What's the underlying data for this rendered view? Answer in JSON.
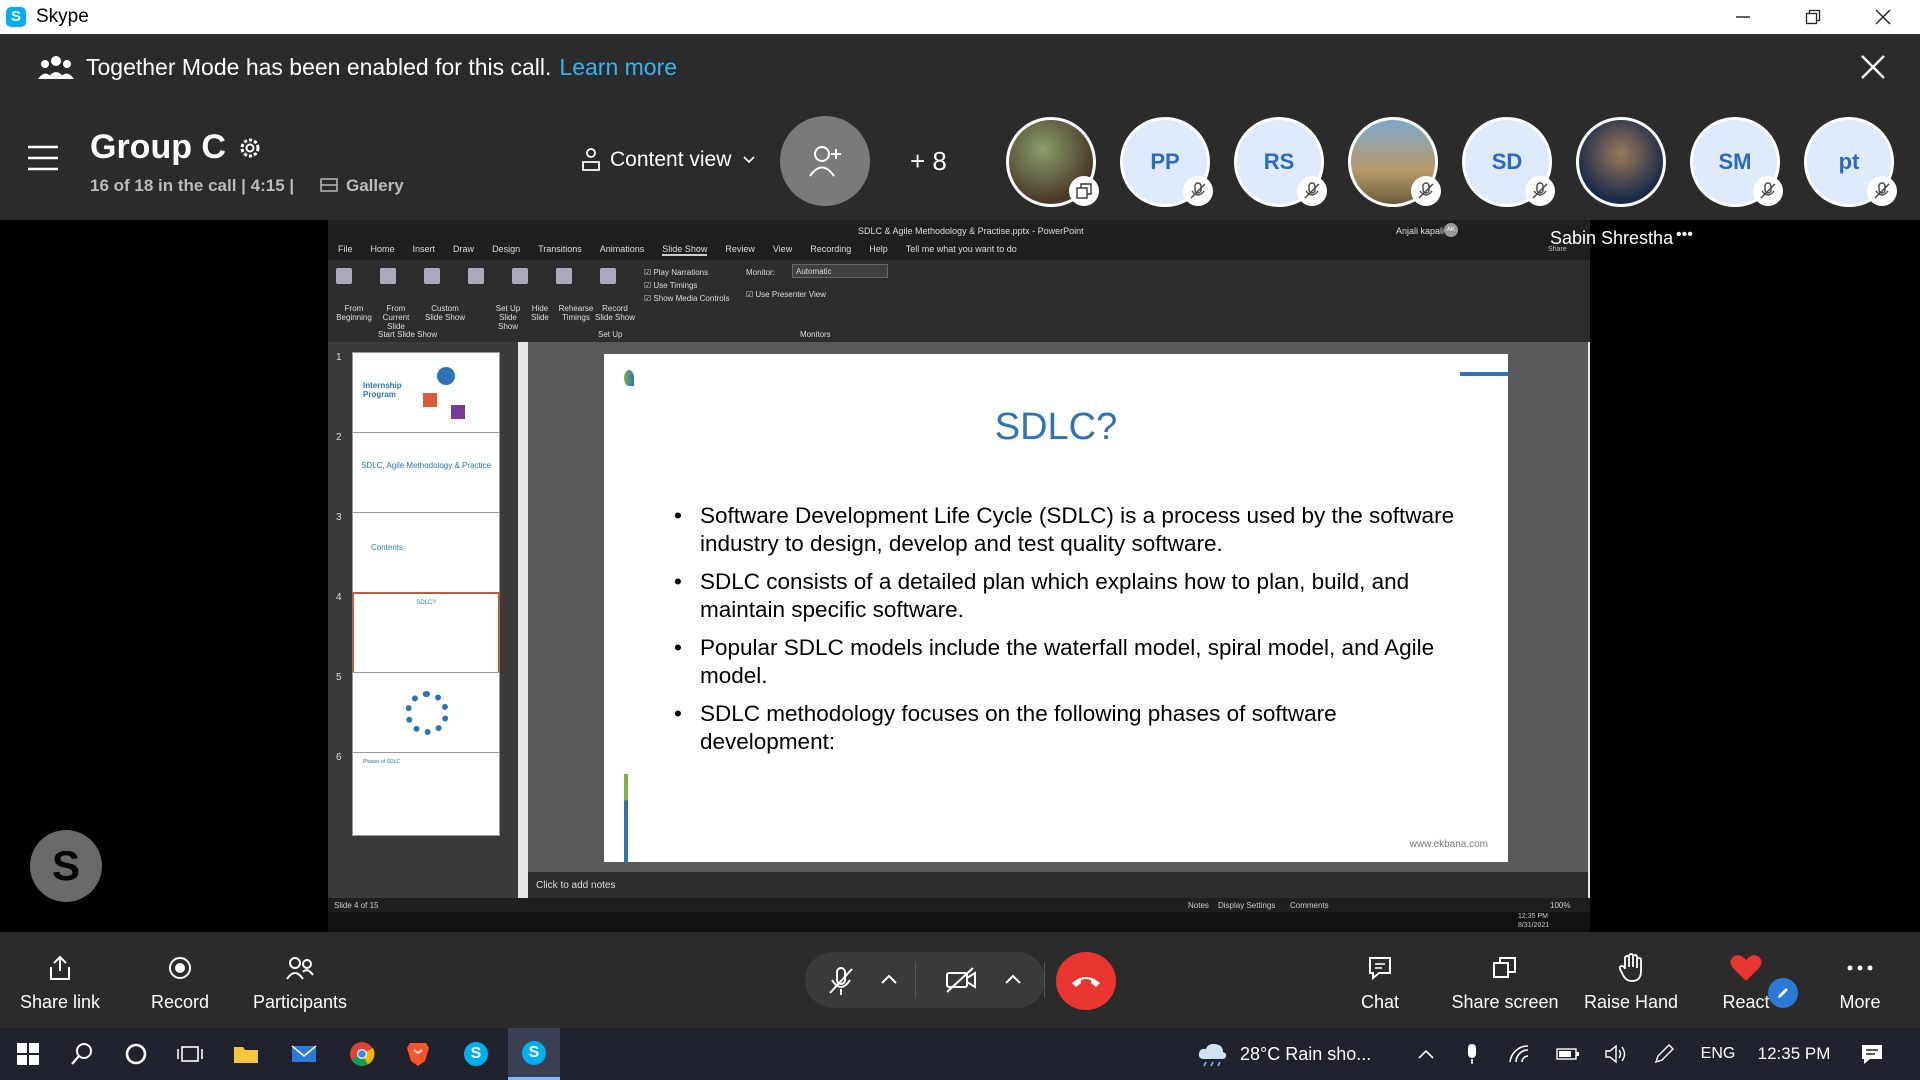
{
  "window": {
    "app_icon_letter": "S",
    "title": "Skype"
  },
  "notice": {
    "text": "Together Mode has been enabled for this call.",
    "link": "Learn more"
  },
  "call": {
    "group_name": "Group C",
    "status": "16 of 18 in the call | 4:15 |",
    "gallery_label": "Gallery",
    "view_label": "Content view",
    "more_count": "+ 8",
    "participants": [
      {
        "initials": "",
        "photo": true
      },
      {
        "initials": "PP",
        "photo": false
      },
      {
        "initials": "RS",
        "photo": false
      },
      {
        "initials": "",
        "photo": true
      },
      {
        "initials": "SD",
        "photo": false
      },
      {
        "initials": "",
        "photo": true
      },
      {
        "initials": "SM",
        "photo": false
      },
      {
        "initials": "pt",
        "photo": false
      }
    ],
    "presenter_name": "Sabin Shrestha",
    "presenter_more": "•••",
    "presenter_avatar_letter": "S"
  },
  "powerpoint": {
    "doc_title": "SDLC & Agile Methodology & Practise.pptx - PowerPoint",
    "user": "Anjali kapali",
    "user_initials": "AK",
    "tabs": [
      "File",
      "Home",
      "Insert",
      "Draw",
      "Design",
      "Transitions",
      "Animations",
      "Slide Show",
      "Review",
      "View",
      "Recording",
      "Help"
    ],
    "tell_me": "Tell me what you want to do",
    "share": "Share",
    "ribbon_buttons": [
      "From Beginning",
      "From Current Slide",
      "Custom Slide Show",
      "Set Up Slide Show",
      "Hide Slide",
      "Rehearse Timings",
      "Record Slide Show"
    ],
    "ribbon_checks": [
      "Play Narrations",
      "Use Timings",
      "Show Media Controls"
    ],
    "monitor_label": "Monitor:",
    "monitor_value": "Automatic",
    "presenter_view": "Use Presenter View",
    "group_labels": [
      "Start Slide Show",
      "Set Up",
      "Monitors"
    ],
    "thumbs": [
      {
        "num": "1",
        "text": "Internship Program"
      },
      {
        "num": "2",
        "text": "SDLC, Agile Methodology & Practice"
      },
      {
        "num": "3",
        "text": "Contents"
      },
      {
        "num": "4",
        "text": "SDLC?"
      },
      {
        "num": "5",
        "text": ""
      },
      {
        "num": "6",
        "text": "Phases of SDLC"
      }
    ],
    "slide": {
      "title": "SDLC?",
      "bullets": [
        "Software Development Life Cycle (SDLC) is a process used by the software industry to design, develop and test quality software.",
        "SDLC consists of a detailed plan which explains how to plan, build, and maintain specific software.",
        "Popular SDLC models include the waterfall model, spiral model, and Agile model.",
        "SDLC methodology focuses on the following phases of software development:"
      ],
      "footer": "www.ekbana.com"
    },
    "notes_placeholder": "Click to add notes",
    "status_slide": "Slide 4 of 15",
    "status_notes": "Notes",
    "status_display": "Display Settings",
    "status_comments": "Comments",
    "zoom": "100%",
    "inner_time": "12:35 PM",
    "inner_date": "8/31/2021"
  },
  "controls": {
    "share_link": "Share link",
    "record": "Record",
    "participants": "Participants",
    "chat": "Chat",
    "share_screen": "Share screen",
    "raise_hand": "Raise Hand",
    "react": "React",
    "more": "More"
  },
  "taskbar": {
    "weather": "28°C  Rain sho...",
    "language": "ENG",
    "time": "12:35 PM"
  },
  "colors": {
    "accent_blue": "#34b6f2",
    "hangup_red": "#e8352f",
    "slide_title": "#2e74b5"
  }
}
